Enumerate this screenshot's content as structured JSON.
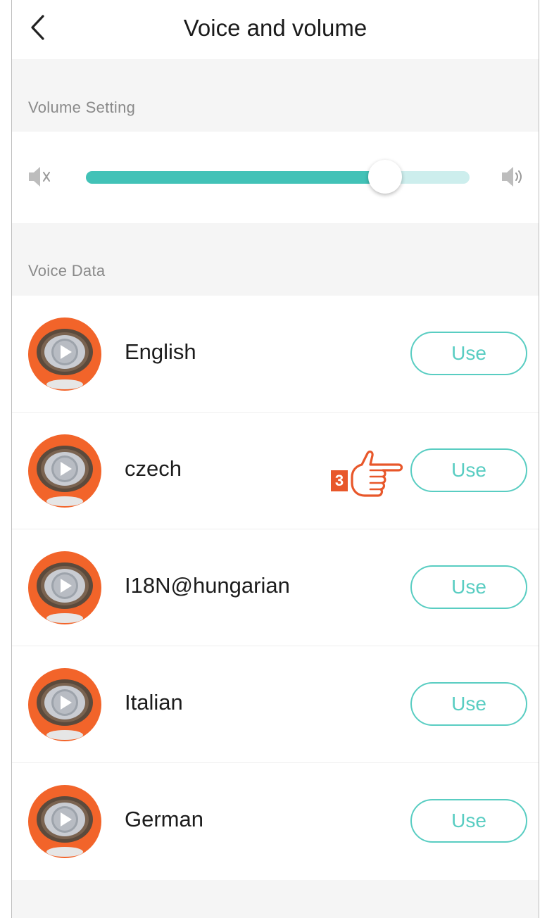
{
  "header": {
    "title": "Voice and volume"
  },
  "volume_section": {
    "label": "Volume Setting",
    "level": 0.78
  },
  "voice_section": {
    "label": "Voice Data",
    "items": [
      {
        "name": "English",
        "action": "Use"
      },
      {
        "name": "czech",
        "action": "Use"
      },
      {
        "name": "I18N@hungarian",
        "action": "Use"
      },
      {
        "name": "Italian",
        "action": "Use"
      },
      {
        "name": "German",
        "action": "Use"
      }
    ]
  },
  "callout": {
    "step": "3"
  },
  "icons": {
    "back": "chevron-left-icon",
    "mute": "volume-mute-icon",
    "loud": "volume-up-icon",
    "voice": "voice-play-icon",
    "pointer": "pointing-hand-icon"
  },
  "colors": {
    "accent": "#42c2b7",
    "track": "#cdeeed",
    "button_border": "#59cdc2",
    "avatar_orange": "#f2642a",
    "callout": "#e8572a"
  }
}
